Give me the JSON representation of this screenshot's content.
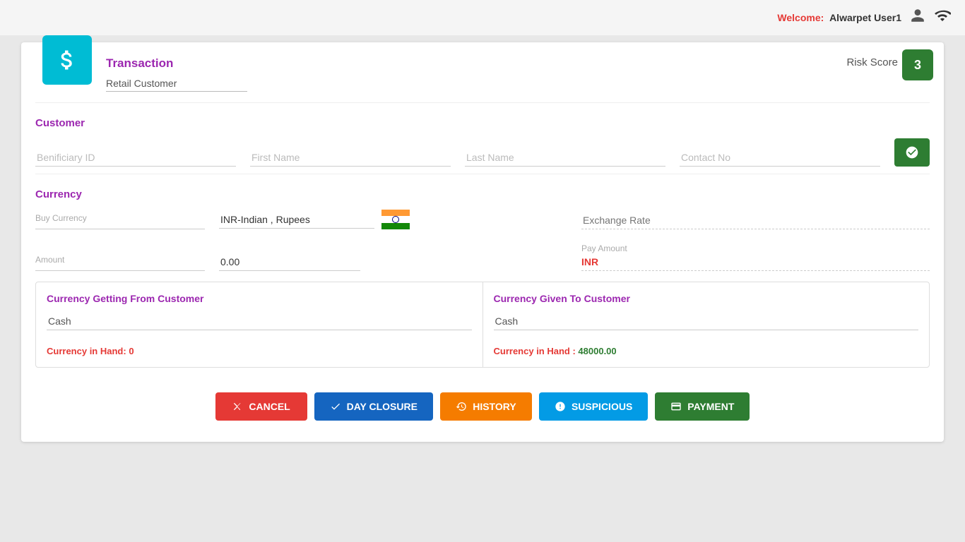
{
  "topbar": {
    "welcome_prefix": "Welcome:",
    "username": "Alwarpet User1"
  },
  "risk_score": {
    "label": "Risk Score",
    "value": "3"
  },
  "transaction": {
    "title": "Transaction",
    "customer_type": "Retail Customer"
  },
  "customer_section": {
    "title": "Customer",
    "beneficiary_id_placeholder": "Benificiary ID",
    "first_name_placeholder": "First Name",
    "last_name_placeholder": "Last Name",
    "contact_no_placeholder": "Contact No"
  },
  "currency_section": {
    "title": "Currency",
    "buy_currency_label": "Buy Currency",
    "buy_currency_value": "INR-Indian , Rupees",
    "exchange_rate_placeholder": "Exchange Rate",
    "amount_label": "Amount",
    "amount_value": "0.00",
    "pay_amount_label": "Pay Amount",
    "pay_amount_value": "INR"
  },
  "currency_boxes": {
    "from_title": "Currency Getting From Customer",
    "from_cash": "Cash",
    "from_currency_in_hand_label": "Currency in Hand:",
    "from_currency_in_hand_value": "0",
    "to_title": "Currency Given To Customer",
    "to_cash": "Cash",
    "to_currency_in_hand_label": "Currency in Hand :",
    "to_currency_in_hand_value": "48000.00"
  },
  "buttons": {
    "cancel": "CANCEL",
    "day_closure": "DAY CLOSURE",
    "history": "HISTORY",
    "suspicious": "SUSPICIOUS",
    "payment": "PAYMENT"
  }
}
